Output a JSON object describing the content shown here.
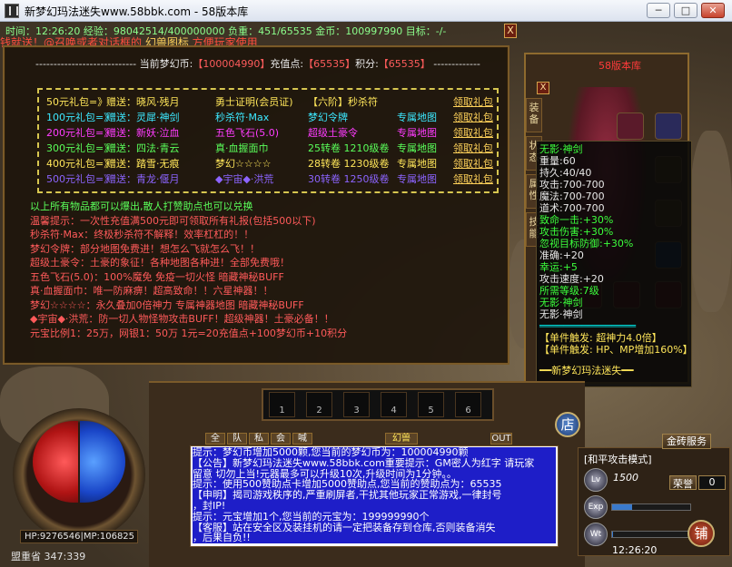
{
  "window": {
    "title": "新梦幻玛法迷失www.58bbk.com - 58版本库",
    "min": "─",
    "max": "□",
    "close": "✕"
  },
  "status_line": "时间：12:26:20 经验：98042514/400000000 负重：451/65535 金币：100997990 目标：-/-",
  "notice": {
    "pre": "钱就送！@召唤或者对话框的",
    "mid": " 幻兽图标 ",
    "post": "方便玩家使用"
  },
  "npc": {
    "close": "X",
    "dash_line": "------------------------------------------------------------------------------------------",
    "account": {
      "p1": "当前梦幻币:",
      "v1": "【100004990】",
      "p2": "充值点:",
      "v2": "【65535】",
      "p3": "积分:",
      "v3": "【65535】"
    },
    "gifts": [
      {
        "c1": "50元礼包=》",
        "c2": "赠送：晓风·残月",
        "c3": "勇士证明(会员证)",
        "c4": "【六阶】秒杀符",
        "c5": "",
        "claim": "领取礼包",
        "color": "#ffe65a"
      },
      {
        "c1": "100元礼包=》",
        "c2": "赠送：灵犀·神剑",
        "c3": "秒杀符·Max",
        "c4": "梦幻令牌",
        "c5": "专属地图",
        "claim": "领取礼包",
        "color": "#3ce8ff"
      },
      {
        "c1": "200元礼包=》",
        "c2": "赠送：新妖·泣血",
        "c3": "五色飞石(5.0)",
        "c4": "超级土豪令",
        "c5": "专属地图",
        "claim": "领取礼包",
        "color": "#ff3cff"
      },
      {
        "c1": "300元礼包=》",
        "c2": "赠送：四法·青云",
        "c3": "真·血握面巾",
        "c4": "25转卷 1210级卷",
        "c5": "专属地图",
        "claim": "领取礼包",
        "color": "#5aff5a"
      },
      {
        "c1": "400元礼包=》",
        "c2": "赠送：踏雪·无痕",
        "c3": "梦幻☆☆☆☆",
        "c4": "28转卷 1230级卷",
        "c5": "专属地图",
        "claim": "领取礼包",
        "color": "#ffe65a"
      },
      {
        "c1": "500元礼包=》",
        "c2": "赠送：青龙·偃月",
        "c3": "◆宇宙◆·洪荒",
        "c4": "30转卷 1250级卷",
        "c5": "专属地图",
        "claim": "领取礼包",
        "color": "#8c64ff"
      }
    ],
    "info": [
      {
        "t": "以上所有物品都可以爆出,散人打赞助点也可以兑换",
        "c": "#5aff5a"
      },
      {
        "t": "温馨提示：一次性充值满500元即可领取所有礼报(包括500以下)",
        "c": "#ff5a5a"
      },
      {
        "t": "秒杀符·Max：终极秒杀符不解释！效率杠杠的！！",
        "c": "#ff5a5a"
      },
      {
        "t": "梦幻令牌：部分地图免费进！想怎么飞就怎么飞！！",
        "c": "#ff5a5a"
      },
      {
        "t": "超级土豪令：土豪的象征！各种地图各种进！全部免费哦！",
        "c": "#ff5a5a"
      },
      {
        "t": "五色飞石(5.0)：100%魔免 免疫一切火怪 暗藏神秘BUFF",
        "c": "#ff5a5a"
      },
      {
        "t": "真·血握面巾：唯一防麻痹！超高致命！！六星神器！！",
        "c": "#ff5a5a"
      },
      {
        "t": "梦幻☆☆☆☆：永久叠加0倍神力 专属神器地图 暗藏神秘BUFF",
        "c": "#ff5a5a"
      },
      {
        "t": "◆宇宙◆·洪荒：防一切人物怪物攻击BUFF！超级神器！土豪必备！！",
        "c": "#ff5a5a"
      },
      {
        "t": "元宝比例1：25万，网银1：50万  1元=20充值点+100梦幻币+10积分",
        "c": "#ff5a5a"
      }
    ]
  },
  "equip": {
    "title": "58版本库",
    "tab1": "装备",
    "tab2": "状态",
    "tab3": "属性",
    "tab4": "技能",
    "close": "X"
  },
  "tooltip": {
    "name": "无影·神剑",
    "lines": [
      {
        "t": "重量:60",
        "c": "#e8e8e8"
      },
      {
        "t": "持久:40/40",
        "c": "#e8e8e8"
      },
      {
        "t": "攻击:700-700",
        "c": "#e8e8e8"
      },
      {
        "t": "魔法:700-700",
        "c": "#e8e8e8"
      },
      {
        "t": "道术:700-700",
        "c": "#e8e8e8"
      },
      {
        "t": "致命一击:+30%",
        "c": "#3cff3c"
      },
      {
        "t": "攻击伤害:+30%",
        "c": "#3cff3c"
      },
      {
        "t": "忽视目标防御:+30%",
        "c": "#3cff3c"
      },
      {
        "t": "准确:+20",
        "c": "#e8e8e8"
      },
      {
        "t": "幸运:+5",
        "c": "#3cff3c"
      },
      {
        "t": "攻击速度:+20",
        "c": "#e8e8e8"
      },
      {
        "t": "所需等级:7级",
        "c": "#3cff3c"
      },
      {
        "t": "无影·神剑",
        "c": "#3cff3c"
      },
      {
        "t": "无影·神剑",
        "c": "#e8e8e8"
      }
    ],
    "sep": "════════════════",
    "trig1": "【单件触发:   超神力4.0倍】",
    "trig2": "【单件触发:  HP、MP增加160%】",
    "footer": "━━新梦幻玛法迷失━━"
  },
  "hud": {
    "hpmp": "HP:9276546|MP:106825",
    "map": "盟重省  347:339",
    "skills": [
      "1",
      "2",
      "3",
      "4",
      "5",
      "6"
    ],
    "chat_tabs": [
      "全",
      "队",
      "私",
      "会",
      "喊"
    ],
    "pet_tab": "幻兽",
    "chat_lines": [
      {
        "t": "提示：梦幻币增加5000颗,您当前的梦幻币为：100004990颗",
        "cls": "hl"
      },
      {
        "t": "【公告】新梦幻玛法迷失www.58bbk.com重要提示：GM密人为红字 请玩家",
        "cls": "hl"
      },
      {
        "t": "留意 切勿上当!元器最多可以升级10次,升级时间为1分钟。。",
        "cls": "hl"
      },
      {
        "t": "提示：使用500赞助点卡增加5000赞助点,您当前的赞助点为：65535",
        "cls": "hl"
      },
      {
        "t": "【申明】揭司游戏秩序的,严重刷屏者,干扰其他玩家正常游戏,一律封号",
        "cls": "hl"
      },
      {
        "t": "，封IP!",
        "cls": "hl"
      },
      {
        "t": "提示：元宝增加1个,您当前的元宝为：199999990个",
        "cls": "hl"
      },
      {
        "t": "【客服】站在安全区及装挂机的请一定把装备存到仓库,否则装备消失",
        "cls": "hl"
      },
      {
        "t": "，后果自负!!",
        "cls": "hl"
      }
    ],
    "shop": "店",
    "pub": "铺",
    "attack_mode": "[和平攻击模式]",
    "level": "1500",
    "gold_btn": "金砖服务",
    "rank_label": "荣誉",
    "rank_val": "0",
    "clock": "12:26:20",
    "lv_lbl": "Lv",
    "exp_lbl": "Exp",
    "wt_lbl": "Wt",
    "out_btn": "OUT"
  }
}
